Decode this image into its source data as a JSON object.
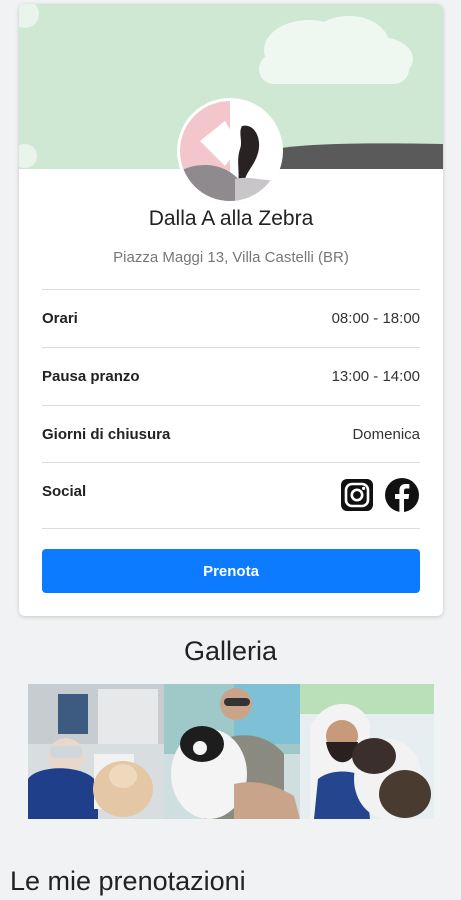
{
  "business": {
    "name": "Dalla A alla Zebra",
    "address": "Piazza Maggi 13, Villa Castelli (BR)"
  },
  "info_rows": [
    {
      "label": "Orari",
      "value": "08:00 - 18:00"
    },
    {
      "label": "Pausa pranzo",
      "value": "13:00 - 14:00"
    },
    {
      "label": "Giorni di chiusura",
      "value": "Domenica"
    },
    {
      "label": "Social",
      "value": ""
    }
  ],
  "social": {
    "icons": [
      "instagram-icon",
      "facebook-icon"
    ]
  },
  "book_button": "Prenota",
  "gallery": {
    "title": "Galleria",
    "photos": 3
  },
  "bookings_section_title": "Le mie prenotazioni",
  "colors": {
    "cover_bg": "#cfe8d4",
    "accent": "#0d7bff"
  }
}
